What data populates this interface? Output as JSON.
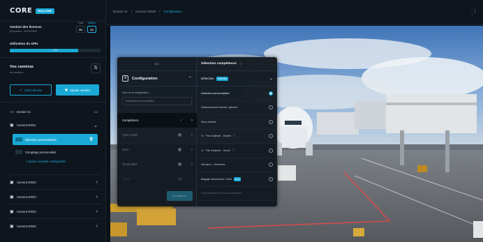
{
  "brand": {
    "logo": "CORE",
    "badge": "REALTIME"
  },
  "sources": {
    "title": "Gestion des licences",
    "subtitle": "Expiration : 00/00/0000",
    "total_label": "Total",
    "total_value": "50",
    "used_label": "Utilisés",
    "used_value": "24"
  },
  "gpu": {
    "title": "Utilisation du GPU",
    "percent_text": "75%",
    "fraction": 0.75
  },
  "cameras": {
    "title": "Vos caméras",
    "subtitle": "en dossiers",
    "create_folder": "Créer dossier",
    "add_camera": "Ajouter caméra",
    "folder": {
      "name": "Dossier 01",
      "count": "6/6"
    },
    "open_camera": "Camera 00021",
    "configs": [
      {
        "label": "Détection personnalisée"
      },
      {
        "label": "Comptage personnalisé"
      }
    ],
    "add_config": "Ajouter nouvelle configuration",
    "list": [
      "Camera 00022",
      "Camera 00023",
      "Camera 00024",
      "Camera 00025"
    ]
  },
  "breadcrumb": [
    "Dossier 01",
    "/",
    "Camera 00000",
    "/",
    "Configuration"
  ],
  "panel": {
    "top_label": "111",
    "config_title": "Configuration",
    "name_label": "Nom de la configuration",
    "name_placeholder": "Détection personnalisée",
    "menu": [
      {
        "label": "Compétence",
        "active": true
      },
      {
        "label": "Type d'objet"
      },
      {
        "label": "Zone"
      },
      {
        "label": "Temporalité"
      },
      {
        "label": "Alerte"
      }
    ],
    "save_label": "Enregistrer",
    "right_title": "Sélection compétence",
    "detection_label": "Détection",
    "detection_tag": "Détection",
    "options": [
      {
        "label": "Détection personnalisée",
        "selected": true
      },
      {
        "label": "Stationnement interdit / gênant"
      },
      {
        "label": "Sens interdit"
      },
      {
        "label": "File d'attente - Entrée"
      },
      {
        "label": "File d'attente - Sortie"
      },
      {
        "label": "Intrusion - Véhicules"
      },
      {
        "label": "Bagage abandonné / isolé",
        "tag": "Beta"
      },
      {
        "label": "Franchissement de zones fermées",
        "dim": true
      }
    ]
  }
}
